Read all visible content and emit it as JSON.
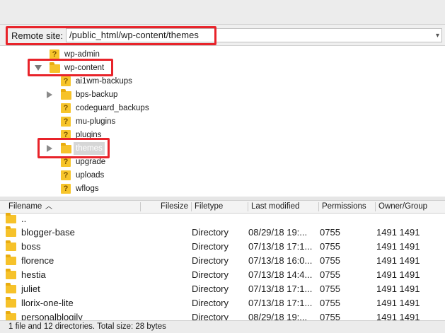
{
  "remote": {
    "label": "Remote site:",
    "path": "/public_html/wp-content/themes",
    "dropdown_icon": "chevron-down-icon"
  },
  "tree": [
    {
      "label": "wp-admin",
      "icon": "question-folder-icon",
      "expander": "none"
    },
    {
      "label": "wp-content",
      "icon": "folder-icon",
      "expander": "expanded"
    },
    {
      "label": "ai1wm-backups",
      "icon": "question-folder-icon",
      "expander": "none"
    },
    {
      "label": "bps-backup",
      "icon": "folder-icon",
      "expander": "collapsed"
    },
    {
      "label": "codeguard_backups",
      "icon": "question-folder-icon",
      "expander": "none"
    },
    {
      "label": "mu-plugins",
      "icon": "question-folder-icon",
      "expander": "none"
    },
    {
      "label": "plugins",
      "icon": "question-folder-icon",
      "expander": "none"
    },
    {
      "label": "themes",
      "icon": "folder-icon",
      "expander": "collapsed",
      "selected": true
    },
    {
      "label": "upgrade",
      "icon": "question-folder-icon",
      "expander": "none"
    },
    {
      "label": "uploads",
      "icon": "question-folder-icon",
      "expander": "none"
    },
    {
      "label": "wflogs",
      "icon": "question-folder-icon",
      "expander": "none"
    }
  ],
  "list": {
    "columns": [
      "Filename",
      "Filesize",
      "Filetype",
      "Last modified",
      "Permissions",
      "Owner/Group"
    ],
    "sort_icon": "sort-ascending-icon",
    "rows": [
      {
        "name": "..",
        "size": "",
        "type": "",
        "modified": "",
        "perms": "",
        "owner": ""
      },
      {
        "name": "blogger-base",
        "size": "",
        "type": "Directory",
        "modified": "08/29/18 19:...",
        "perms": "0755",
        "owner": "1491 1491"
      },
      {
        "name": "boss",
        "size": "",
        "type": "Directory",
        "modified": "07/13/18 17:1...",
        "perms": "0755",
        "owner": "1491 1491"
      },
      {
        "name": "florence",
        "size": "",
        "type": "Directory",
        "modified": "07/13/18 16:0...",
        "perms": "0755",
        "owner": "1491 1491"
      },
      {
        "name": "hestia",
        "size": "",
        "type": "Directory",
        "modified": "07/13/18 14:4...",
        "perms": "0755",
        "owner": "1491 1491"
      },
      {
        "name": "juliet",
        "size": "",
        "type": "Directory",
        "modified": "07/13/18 17:1...",
        "perms": "0755",
        "owner": "1491 1491"
      },
      {
        "name": "llorix-one-lite",
        "size": "",
        "type": "Directory",
        "modified": "07/13/18 17:1...",
        "perms": "0755",
        "owner": "1491 1491"
      },
      {
        "name": "personalblogily",
        "size": "",
        "type": "Directory",
        "modified": "08/29/18 19:...",
        "perms": "0755",
        "owner": "1491 1491"
      }
    ]
  },
  "status": "1 file and 12 directories. Total size: 28 bytes",
  "colors": {
    "highlight": "#e8232a",
    "folder": "#f6c22a"
  }
}
